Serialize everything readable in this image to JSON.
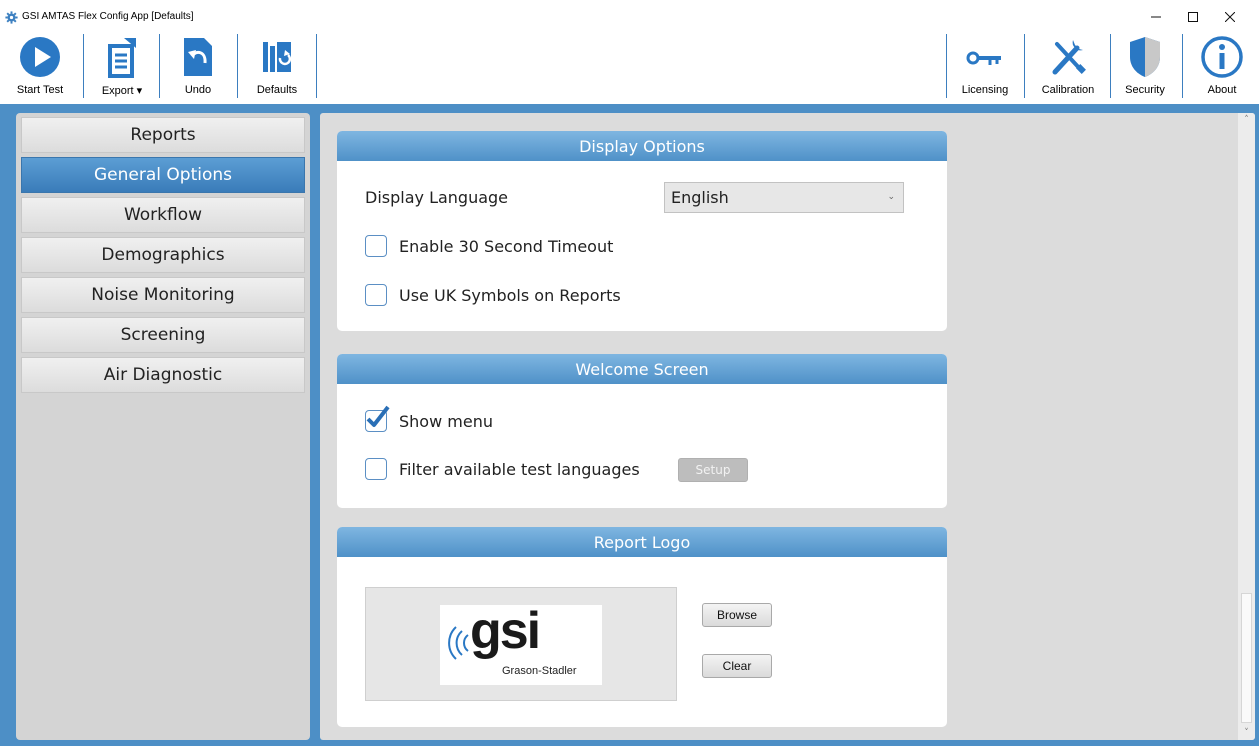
{
  "window": {
    "title": "GSI AMTAS Flex Config App [Defaults]",
    "minimize": "–",
    "maximize": "☐",
    "close": "✕"
  },
  "toolbar": {
    "left": [
      {
        "label": "Start Test",
        "icon": "play-icon"
      },
      {
        "label": "Export ▾",
        "icon": "export-icon"
      },
      {
        "label": "Undo",
        "icon": "undo-icon"
      },
      {
        "label": "Defaults",
        "icon": "defaults-icon"
      }
    ],
    "right": [
      {
        "label": "Licensing",
        "icon": "key-icon"
      },
      {
        "label": "Calibration",
        "icon": "tools-icon"
      },
      {
        "label": "Security",
        "icon": "shield-icon"
      },
      {
        "label": "About",
        "icon": "info-icon"
      }
    ]
  },
  "sidebar": {
    "items": [
      {
        "label": "Reports",
        "active": false
      },
      {
        "label": "General Options",
        "active": true
      },
      {
        "label": "Workflow",
        "active": false
      },
      {
        "label": "Demographics",
        "active": false
      },
      {
        "label": "Noise Monitoring",
        "active": false
      },
      {
        "label": "Screening",
        "active": false
      },
      {
        "label": "Air Diagnostic",
        "active": false
      }
    ]
  },
  "display_options": {
    "header": "Display Options",
    "language_label": "Display Language",
    "language_value": "English",
    "timeout_label": "Enable 30 Second Timeout",
    "timeout_checked": false,
    "uk_label": "Use UK Symbols on Reports",
    "uk_checked": false
  },
  "welcome_screen": {
    "header": "Welcome Screen",
    "show_menu_label": "Show menu",
    "show_menu_checked": true,
    "filter_label": "Filter available test languages",
    "filter_checked": false,
    "setup_label": "Setup"
  },
  "report_logo": {
    "header": "Report Logo",
    "logo_text": "gsi",
    "logo_subtext": "Grason-Stadler",
    "browse_label": "Browse",
    "clear_label": "Clear"
  },
  "colors": {
    "accent": "#4d8fc6",
    "header_gradient_top": "#7fb6e1",
    "header_gradient_bottom": "#4f91c8",
    "active_nav": "#3a7cb9"
  }
}
